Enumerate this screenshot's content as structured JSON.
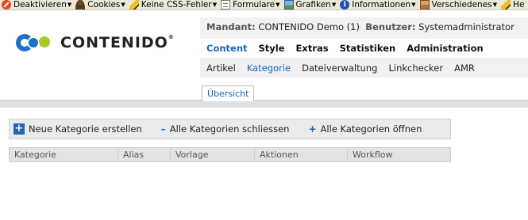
{
  "toolbar": {
    "items": [
      {
        "label": "Deaktivieren",
        "icon": "disable-icon"
      },
      {
        "label": "Cookies",
        "icon": "cookie-icon"
      },
      {
        "label": "Keine CSS-Fehler",
        "icon": "pencil-icon"
      },
      {
        "label": "Formulare",
        "icon": "form-icon"
      },
      {
        "label": "Grafiken",
        "icon": "image-icon"
      },
      {
        "label": "Informationen",
        "icon": "info-icon"
      },
      {
        "label": "Verschiedenes",
        "icon": "misc-icon"
      },
      {
        "label": "He",
        "icon": "pencil-icon"
      }
    ]
  },
  "header": {
    "logo_text": "CONTENIDO",
    "mandant_label": "Mandant:",
    "mandant_value": "CONTENIDO Demo (1)",
    "benutzer_label": "Benutzer:",
    "benutzer_value": "Systemadministrator"
  },
  "mainnav": [
    "Content",
    "Style",
    "Extras",
    "Statistiken",
    "Administration"
  ],
  "subnav": [
    "Artikel",
    "Kategorie",
    "Dateiverwaltung",
    "Linkchecker",
    "AMR"
  ],
  "tab": {
    "label": "Übersicht"
  },
  "actions": {
    "new": "Neue Kategorie erstellen",
    "collapse_symbol": "–",
    "collapse": "Alle Kategorien schliessen",
    "expand_symbol": "+",
    "expand": "Alle Kategorien öffnen"
  },
  "table": {
    "columns": [
      "Kategorie",
      "Alias",
      "Vorlage",
      "Aktionen",
      "Workflow"
    ]
  },
  "colors": {
    "accent": "#1766b8",
    "brand_blue": "#1e6fc5",
    "brand_green": "#a8c82a"
  }
}
